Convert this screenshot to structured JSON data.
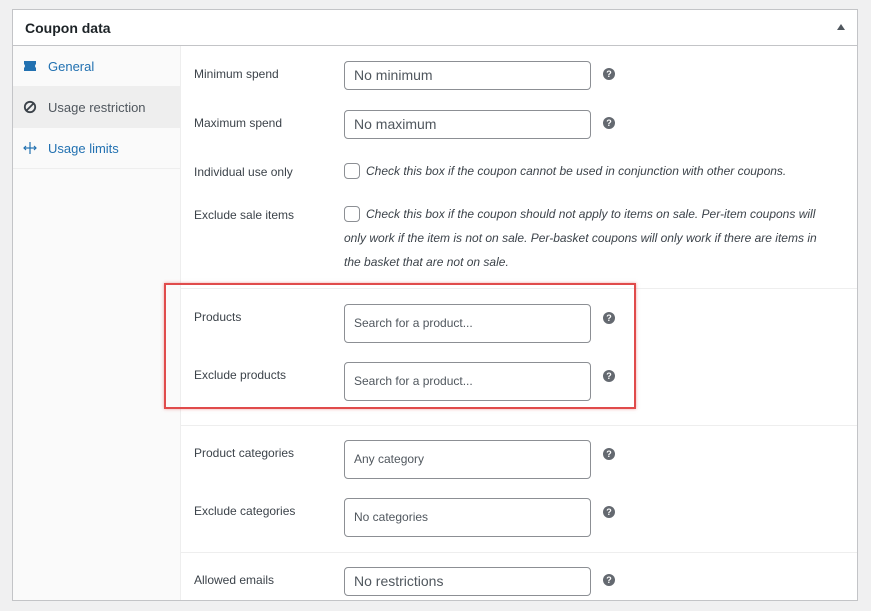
{
  "panel": {
    "title": "Coupon data",
    "toggle_icon": "collapse-arrow-icon"
  },
  "tabs": [
    {
      "label": "General",
      "icon": "ticket-icon",
      "active": false
    },
    {
      "label": "Usage restriction",
      "icon": "block-icon",
      "active": true
    },
    {
      "label": "Usage limits",
      "icon": "limits-icon",
      "active": false
    }
  ],
  "fields": {
    "min_spend": {
      "label": "Minimum spend",
      "placeholder": "No minimum"
    },
    "max_spend": {
      "label": "Maximum spend",
      "placeholder": "No maximum"
    },
    "individual_use": {
      "label": "Individual use only",
      "description": "Check this box if the coupon cannot be used in conjunction with other coupons."
    },
    "exclude_sale": {
      "label": "Exclude sale items",
      "description": "Check this box if the coupon should not apply to items on sale. Per-item coupons will only work if the item is not on sale. Per-basket coupons will only work if there are items in the basket that are not on sale."
    },
    "products": {
      "label": "Products",
      "placeholder": "Search for a product..."
    },
    "exclude_products": {
      "label": "Exclude products",
      "placeholder": "Search for a product..."
    },
    "product_categories": {
      "label": "Product categories",
      "placeholder": "Any category"
    },
    "exclude_categories": {
      "label": "Exclude categories",
      "placeholder": "No categories"
    },
    "allowed_emails": {
      "label": "Allowed emails",
      "placeholder": "No restrictions"
    }
  },
  "help_glyph": "?",
  "colors": {
    "link": "#2271b1",
    "highlight": "#e04b4b",
    "border": "#c3c4c7"
  }
}
